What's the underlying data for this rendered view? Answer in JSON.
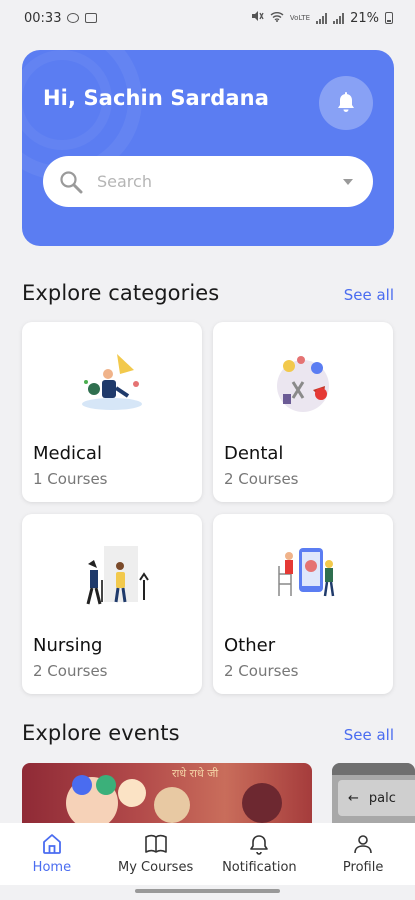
{
  "status_bar": {
    "time": "00:33",
    "battery": "21%",
    "network_label": "VoLTE"
  },
  "header": {
    "greeting": "Hi, Sachin Sardana",
    "search_placeholder": "Search",
    "accent_color": "#5b7df2"
  },
  "categories": {
    "title": "Explore categories",
    "see_all": "See all",
    "items": [
      {
        "name": "Medical",
        "count": "1 Courses",
        "icon": "medical-illustration"
      },
      {
        "name": "Dental",
        "count": "2 Courses",
        "icon": "dental-illustration"
      },
      {
        "name": "Nursing",
        "count": "2 Courses",
        "icon": "nursing-illustration"
      },
      {
        "name": "Other",
        "count": "2 Courses",
        "icon": "other-illustration"
      }
    ]
  },
  "events": {
    "title": "Explore events",
    "see_all": "See all",
    "cards": [
      {
        "caption": "राधे राधे जी"
      },
      {
        "caption": "palc"
      }
    ]
  },
  "bottom_nav": {
    "active_color": "#4a6cf0",
    "items": [
      {
        "label": "Home",
        "icon": "home-icon",
        "active": true
      },
      {
        "label": "My Courses",
        "icon": "book-icon",
        "active": false
      },
      {
        "label": "Notification",
        "icon": "bell-icon",
        "active": false
      },
      {
        "label": "Profile",
        "icon": "user-icon",
        "active": false
      }
    ]
  }
}
